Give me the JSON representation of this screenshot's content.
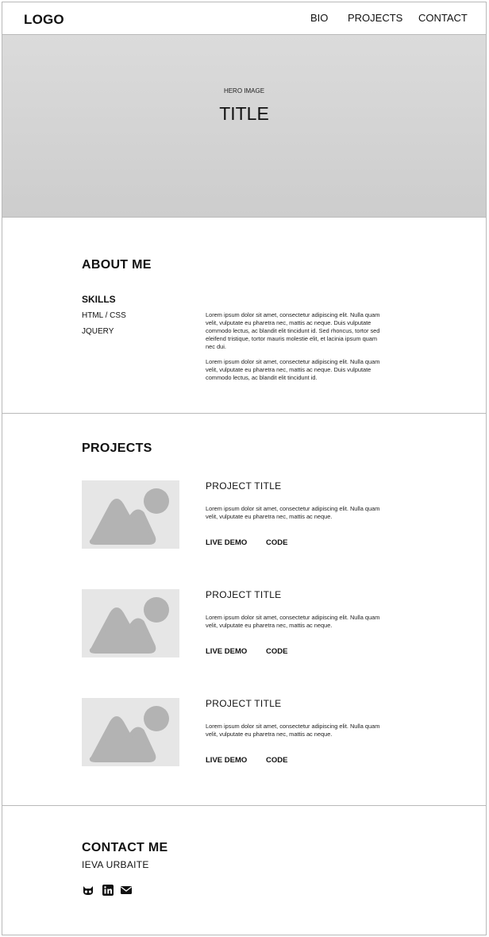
{
  "header": {
    "logo": "LOGO",
    "nav": [
      {
        "label": "BIO"
      },
      {
        "label": "PROJECTS"
      },
      {
        "label": "CONTACT"
      }
    ]
  },
  "hero": {
    "label": "HERO IMAGE",
    "title": "TITLE"
  },
  "about": {
    "heading": "ABOUT ME",
    "skills_title": "SKILLS",
    "skills": [
      "HTML / CSS",
      "JQUERY"
    ],
    "paragraphs": [
      "Lorem ipsum dolor sit amet, consectetur adipiscing elit. Nulla quam velit, vulputate eu pharetra nec, mattis ac neque. Duis vulputate commodo lectus, ac blandit elit tincidunt id. Sed rhoncus, tortor sed eleifend tristique, tortor mauris molestie elit, et lacinia ipsum quam nec dui.",
      "Lorem ipsum dolor sit amet, consectetur adipiscing elit. Nulla quam velit, vulputate eu pharetra nec, mattis ac neque. Duis vulputate commodo lectus, ac blandit elit tincidunt id."
    ]
  },
  "projects": {
    "heading": "PROJECTS",
    "items": [
      {
        "title": "PROJECT TITLE",
        "description": "Lorem ipsum dolor sit amet, consectetur adipiscing elit. Nulla quam velit, vulputate eu pharetra nec, mattis ac neque.",
        "demo_label": "LIVE DEMO",
        "code_label": "CODE"
      },
      {
        "title": "PROJECT TITLE",
        "description": "Lorem ipsum dolor sit amet, consectetur adipiscing elit. Nulla quam velit, vulputate eu pharetra nec, mattis ac neque.",
        "demo_label": "LIVE DEMO",
        "code_label": "CODE"
      },
      {
        "title": "PROJECT TITLE",
        "description": "Lorem ipsum dolor sit amet, consectetur adipiscing elit. Nulla quam velit, vulputate eu pharetra nec, mattis ac neque.",
        "demo_label": "LIVE DEMO",
        "code_label": "CODE"
      }
    ]
  },
  "contact": {
    "heading": "CONTACT ME",
    "name": "IEVA URBAITE",
    "icons": [
      "github-icon",
      "linkedin-icon",
      "envelope-icon"
    ]
  },
  "colors": {
    "hero_bg": "#d4d4d4",
    "placeholder_bg": "#e6e6e6",
    "placeholder_shape": "#b3b3b3",
    "border": "#b9b9b9"
  }
}
